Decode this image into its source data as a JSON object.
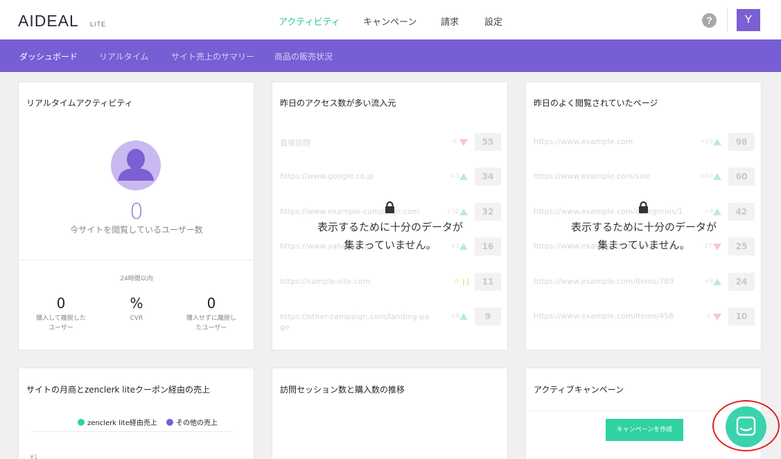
{
  "header": {
    "logo_main": "AIDEAL",
    "logo_sub": "LITE",
    "nav": [
      "アクティビティ",
      "キャンペーン",
      "請求",
      "設定"
    ],
    "active_nav": "アクティビティ",
    "help_label": "?",
    "user_initial": "Y"
  },
  "subnav": {
    "items": [
      "ダッシュボード",
      "リアルタイム",
      "サイト売上のサマリー",
      "商品の販売状況"
    ]
  },
  "realtime": {
    "title": "リアルタイムアクティビティ",
    "count": "0",
    "count_label": "今サイトを閲覧しているユーザー数",
    "period": "24時間以内",
    "stats": [
      {
        "value": "0",
        "label_line1": "購入して離脱した",
        "label_line2": "ユーザー"
      },
      {
        "value": "%",
        "label_line1": "CVR",
        "label_line2": ""
      },
      {
        "value": "0",
        "label_line1": "購入せずに離脱し",
        "label_line2": "たユーザー"
      }
    ]
  },
  "referrers": {
    "title": "昨日のアクセス数が多い流入元",
    "rows": [
      {
        "url": "直接訪問",
        "url2": "",
        "delta": "-6",
        "trend": "down",
        "count": "55"
      },
      {
        "url": "https://www.google.co.jp",
        "url2": "",
        "delta": "+3",
        "trend": "up",
        "count": "34"
      },
      {
        "url": "https://www.example-campaign.com",
        "url2": "",
        "delta": "+32",
        "trend": "up",
        "count": "32"
      },
      {
        "url": "https://www.yahoo.co.jp",
        "url2": "",
        "delta": "+1",
        "trend": "up",
        "count": "16"
      },
      {
        "url": "https://sample-site.com",
        "url2": "",
        "delta": "0",
        "trend": "flat",
        "count": "11"
      },
      {
        "url": "https://other-campaign.com/landing-pa",
        "url2": "ge",
        "delta": "+9",
        "trend": "up",
        "count": "9"
      }
    ],
    "lock_message_line1": "表示するために十分のデータが",
    "lock_message_line2": "集まっていません。"
  },
  "pages": {
    "title": "昨日のよく閲覧されていたページ",
    "rows": [
      {
        "url": "https://www.example.com",
        "delta": "+23",
        "trend": "up",
        "count": "98"
      },
      {
        "url": "https://www.example.com/sale",
        "delta": "+60",
        "trend": "up",
        "count": "60"
      },
      {
        "url": "https://www.example.com/categories/1",
        "delta": "+4",
        "trend": "up",
        "count": "42"
      },
      {
        "url": "https://www.example.com/items/123",
        "delta": "-27",
        "trend": "down",
        "count": "25"
      },
      {
        "url": "https://www.example.com/items/789",
        "delta": "+6",
        "trend": "up",
        "count": "24"
      },
      {
        "url": "https://www.example.com/items/456",
        "delta": "-2",
        "trend": "down",
        "count": "10"
      }
    ],
    "lock_message_line1": "表示するために十分のデータが",
    "lock_message_line2": "集まっていません。"
  },
  "sales_chart": {
    "title": "サイトの月商とzenclerk liteクーポン経由の売上",
    "legend": [
      {
        "label": "zenclerk lite経由売上",
        "color": "#2fd2a0"
      },
      {
        "label": "その他の売上",
        "color": "#775ed4"
      }
    ],
    "y_label": "¥1"
  },
  "sessions_chart": {
    "title": "訪問セッション数と購入数の推移"
  },
  "campaigns": {
    "title": "アクティブキャンペーン",
    "create_button": "キャンペーンを作成"
  },
  "colors": {
    "accent_green": "#2fd2a0",
    "accent_purple": "#775ed4",
    "highlight_ring": "#e01e1e"
  }
}
